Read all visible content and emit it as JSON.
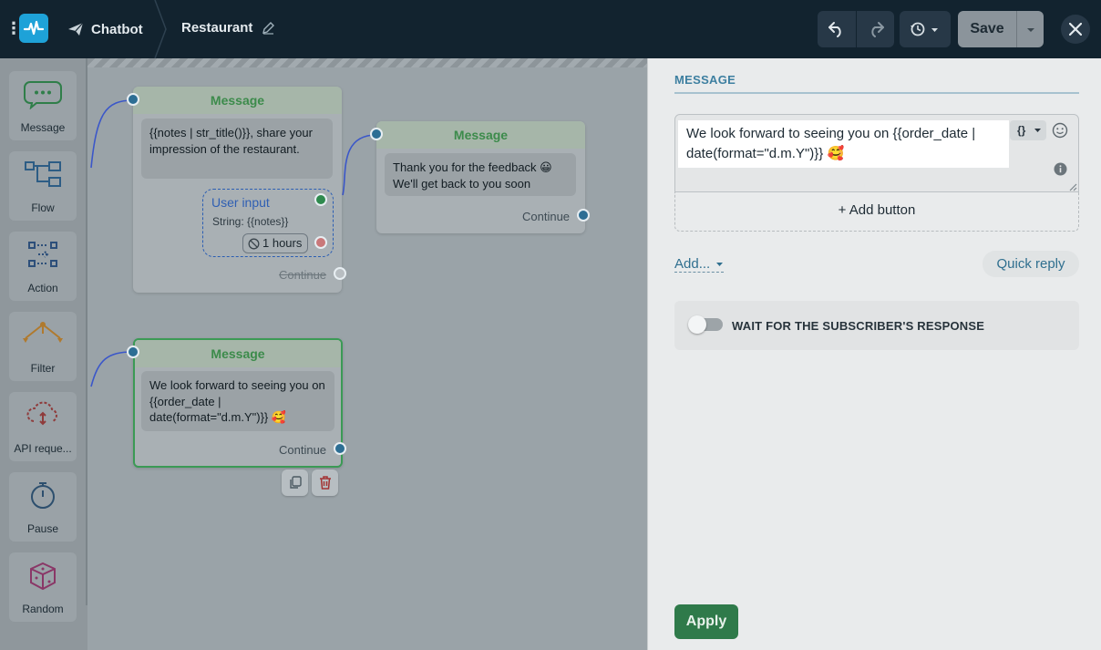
{
  "topbar": {
    "section": "Chatbot",
    "title": "Restaurant",
    "save_label": "Save"
  },
  "sidebar": {
    "items": [
      {
        "label": "Message",
        "icon": "chat-bubble-icon"
      },
      {
        "label": "Flow",
        "icon": "flow-icon"
      },
      {
        "label": "Action",
        "icon": "action-icon"
      },
      {
        "label": "Filter",
        "icon": "filter-icon"
      },
      {
        "label": "API reque...",
        "icon": "api-cloud-icon"
      },
      {
        "label": "Pause",
        "icon": "stopwatch-icon"
      },
      {
        "label": "Random",
        "icon": "dice-icon"
      }
    ]
  },
  "canvas": {
    "node1": {
      "header": "Message",
      "text": "{{notes | str_title()}}, share your impression of the restaurant.",
      "user_input_title": "User input",
      "user_input_type": "String: {{notes}}",
      "timeout": "1 hours",
      "continue": "Continue"
    },
    "node2": {
      "header": "Message",
      "text": "Thank you for the feedback 😀 We'll get back to you soon",
      "continue": "Continue"
    },
    "node3": {
      "header": "Message",
      "text": "We look forward to seeing you on {{order_date | date(format=\"d.m.Y\")}} 🥰",
      "continue": "Continue"
    }
  },
  "panel": {
    "tab": "MESSAGE",
    "message_text": "We look forward to seeing you on {{order_date | date(format=\"d.m.Y\")}} 🥰",
    "var_button": "{}",
    "add_button": "+ Add button",
    "add_menu": "Add...",
    "quick_reply": "Quick reply",
    "wait_label": "WAIT FOR THE SUBSCRIBER'S RESPONSE",
    "wait_enabled": false,
    "apply": "Apply"
  },
  "colors": {
    "topbar": "#12232f",
    "accent_blue": "#1ea2d8",
    "node_header_green": "#3c8b4b",
    "apply_green": "#2f7a4a",
    "link_blue": "#2f6f8f"
  }
}
